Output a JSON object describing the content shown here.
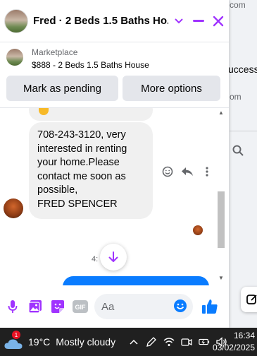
{
  "background": {
    "site": "dreamspakistan.com",
    "partial_text_1": "uccessf",
    "partial_text_2": "om"
  },
  "chat": {
    "title": "Fred · 2 Beds 1.5 Baths Ho...",
    "marketplace_label": "Marketplace",
    "listing": "$888 - 2 Beds 1.5 Baths House",
    "buttons": {
      "mark_pending": "Mark as pending",
      "more_options": "More options"
    },
    "message": "708-243-3120, very interested in renting your home.Please contact me soon as possible,\nFRED SPENCER",
    "time_fragment": "4:",
    "composer_placeholder": "Aa",
    "colors": {
      "accent": "#a033ff",
      "messenger_blue": "#0a7cff",
      "bubble_gray": "#f0f0f0"
    }
  },
  "taskbar": {
    "weather_badge": "1",
    "temperature": "19°C",
    "condition": "Mostly cloudy",
    "time": "16:34",
    "date": "03/02/2025"
  }
}
